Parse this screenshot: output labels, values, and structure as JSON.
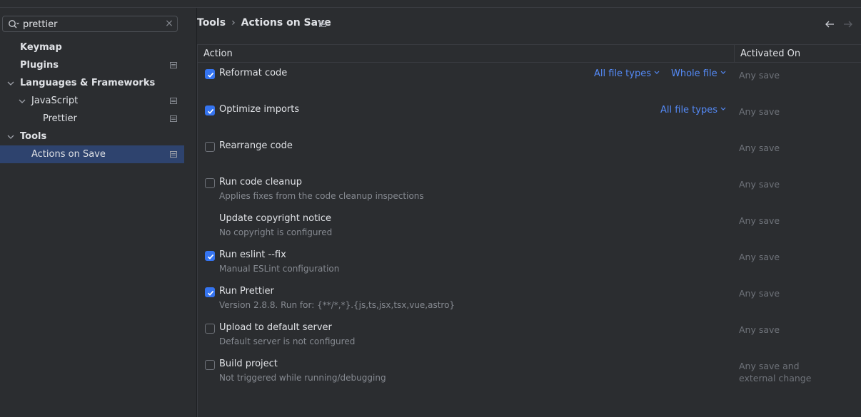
{
  "search": {
    "value": "prettier"
  },
  "sidebar": {
    "items": [
      {
        "label": "Keymap"
      },
      {
        "label": "Plugins"
      },
      {
        "label": "Languages & Frameworks"
      },
      {
        "label": "JavaScript"
      },
      {
        "label": "Prettier"
      },
      {
        "label": "Tools"
      },
      {
        "label": "Actions on Save"
      }
    ]
  },
  "breadcrumb": {
    "parent": "Tools",
    "current": "Actions on Save"
  },
  "table": {
    "headers": {
      "action": "Action",
      "activated": "Activated On"
    },
    "rows": [
      {
        "title": "Reformat code",
        "subtitle": "",
        "checked": true,
        "activated": "Any save",
        "dropdowns": [
          "All file types",
          "Whole file"
        ]
      },
      {
        "title": "Optimize imports",
        "subtitle": "",
        "checked": true,
        "activated": "Any save",
        "dropdowns": [
          "All file types"
        ]
      },
      {
        "title": "Rearrange code",
        "subtitle": "",
        "checked": false,
        "activated": "Any save"
      },
      {
        "title": "Run code cleanup",
        "subtitle": "Applies fixes from the code cleanup inspections",
        "checked": false,
        "activated": "Any save"
      },
      {
        "title": "Update copyright notice",
        "subtitle": "No copyright is configured",
        "checked": null,
        "activated": "Any save"
      },
      {
        "title": "Run eslint --fix",
        "subtitle": "Manual ESLint configuration",
        "checked": true,
        "activated": "Any save"
      },
      {
        "title": "Run Prettier",
        "subtitle": "Version 2.8.8. Run for: {**/*,*}.{js,ts,jsx,tsx,vue,astro}",
        "checked": true,
        "activated": "Any save"
      },
      {
        "title": "Upload to default server",
        "subtitle": "Default server is not configured",
        "checked": false,
        "activated": "Any save"
      },
      {
        "title": "Build project",
        "subtitle": "Not triggered while running/debugging",
        "checked": false,
        "activated_line1": "Any save and",
        "activated_line2": "external change"
      }
    ]
  },
  "colors": {
    "background": "#2b2d30",
    "selection": "#2e436e",
    "accent": "#3574f0",
    "link": "#548af7",
    "muted": "#868a91"
  }
}
